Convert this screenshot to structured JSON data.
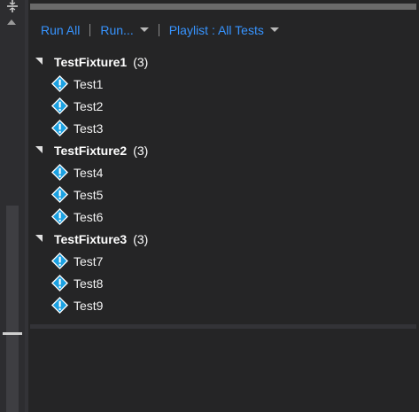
{
  "toolbar": {
    "run_all": "Run All",
    "run": "Run...",
    "playlist": "Playlist : All Tests"
  },
  "fixtures": [
    {
      "name": "TestFixture1",
      "count": "(3)",
      "tests": [
        "Test1",
        "Test2",
        "Test3"
      ]
    },
    {
      "name": "TestFixture2",
      "count": "(3)",
      "tests": [
        "Test4",
        "Test5",
        "Test6"
      ]
    },
    {
      "name": "TestFixture3",
      "count": "(3)",
      "tests": [
        "Test7",
        "Test8",
        "Test9"
      ]
    }
  ],
  "icons": {
    "test_status": "warning-not-run-icon",
    "expander": "expanded-triangle-icon",
    "gutter_top": "split-handle-icon",
    "gutter_up": "scroll-up-arrow-icon"
  },
  "colors": {
    "link": "#3794ff",
    "status_icon_fill": "#1ba1e2",
    "background": "#252526"
  }
}
